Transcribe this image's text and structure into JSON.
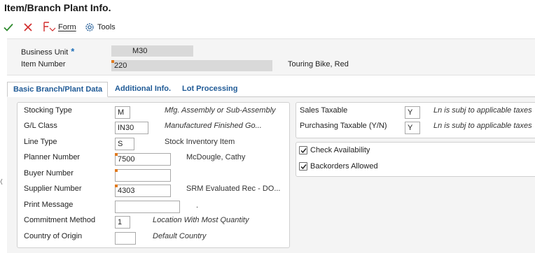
{
  "window": {
    "title": "Item/Branch Plant Info."
  },
  "toolbar": {
    "ok_icon": "checkmark-icon",
    "cancel_icon": "close-icon",
    "form_label": "Form",
    "tools_label": "Tools"
  },
  "header": {
    "business_unit_label": "Business Unit",
    "business_unit_value": "M30",
    "item_number_label": "Item Number",
    "item_number_value": "220",
    "item_description": "Touring Bike, Red"
  },
  "tabs": [
    {
      "label": "Basic Branch/Plant Data",
      "active": true
    },
    {
      "label": "Additional Info.",
      "active": false
    },
    {
      "label": "Lot Processing",
      "active": false
    }
  ],
  "left_form": {
    "stocking_type": {
      "label": "Stocking Type",
      "value": "M",
      "desc": "Mfg. Assembly or Sub-Assembly"
    },
    "gl_class": {
      "label": "G/L Class",
      "value": "IN30",
      "desc": "Manufactured Finished Go..."
    },
    "line_type": {
      "label": "Line Type",
      "value": "S",
      "desc": "Stock Inventory Item"
    },
    "planner_number": {
      "label": "Planner Number",
      "value": "7500",
      "desc": "McDougle, Cathy"
    },
    "buyer_number": {
      "label": "Buyer Number",
      "value": ""
    },
    "supplier_number": {
      "label": "Supplier Number",
      "value": "4303",
      "desc": "SRM Evaluated Rec - DO..."
    },
    "print_message": {
      "label": "Print Message",
      "value": "",
      "desc": "."
    },
    "commitment_method": {
      "label": "Commitment Method",
      "value": "1",
      "desc": "Location With Most Quantity"
    },
    "country_of_origin": {
      "label": "Country of Origin",
      "value": "",
      "desc": "Default Country"
    }
  },
  "right_form": {
    "sales_taxable": {
      "label": "Sales Taxable",
      "value": "Y",
      "desc": "Ln is subj to applicable taxes"
    },
    "purchasing_taxable": {
      "label": "Purchasing Taxable (Y/N)",
      "value": "Y",
      "desc": "Ln is subj to applicable taxes"
    },
    "check_availability": {
      "label": "Check Availability",
      "checked": true
    },
    "backorders_allowed": {
      "label": "Backorders Allowed",
      "checked": true
    }
  },
  "colors": {
    "accent": "#1f5a96",
    "ok_green": "#2e8b2e",
    "cancel_red": "#d12a2a",
    "flag_orange": "#e07a1f"
  }
}
